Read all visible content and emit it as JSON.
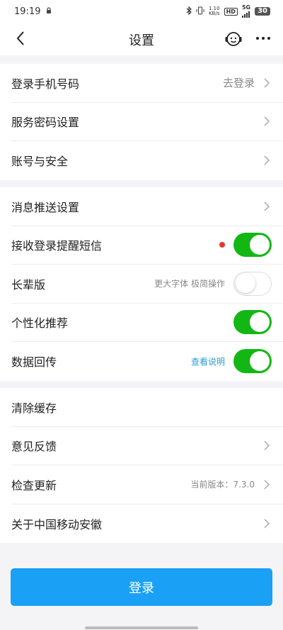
{
  "status_bar": {
    "time": "19:19",
    "speed": "1.10",
    "speed_unit": "KB/s",
    "hd": "HD",
    "network": "5G",
    "battery": "30"
  },
  "nav": {
    "title": "设置"
  },
  "section1": [
    {
      "label": "登录手机号码",
      "hint": "去登录"
    },
    {
      "label": "服务密码设置"
    },
    {
      "label": "账号与安全"
    }
  ],
  "section2": [
    {
      "label": "消息推送设置"
    },
    {
      "label": "接收登录提醒短信",
      "toggle": true
    },
    {
      "label": "长辈版",
      "hint": "更大字体 极简操作",
      "toggle": false
    },
    {
      "label": "个性化推荐",
      "toggle": true
    },
    {
      "label": "数据回传",
      "link": "查看说明",
      "toggle": true
    }
  ],
  "section3": [
    {
      "label": "清除缓存"
    },
    {
      "label": "意见反馈"
    },
    {
      "label": "检查更新",
      "hint": "当前版本：7.3.0"
    },
    {
      "label": "关于中国移动安徽"
    }
  ],
  "login_button": "登录",
  "colors": {
    "toggle_on": "#13b713",
    "primary_button": "#1aa0f5",
    "link": "#2b9bd6",
    "alert_dot": "#e53935"
  }
}
